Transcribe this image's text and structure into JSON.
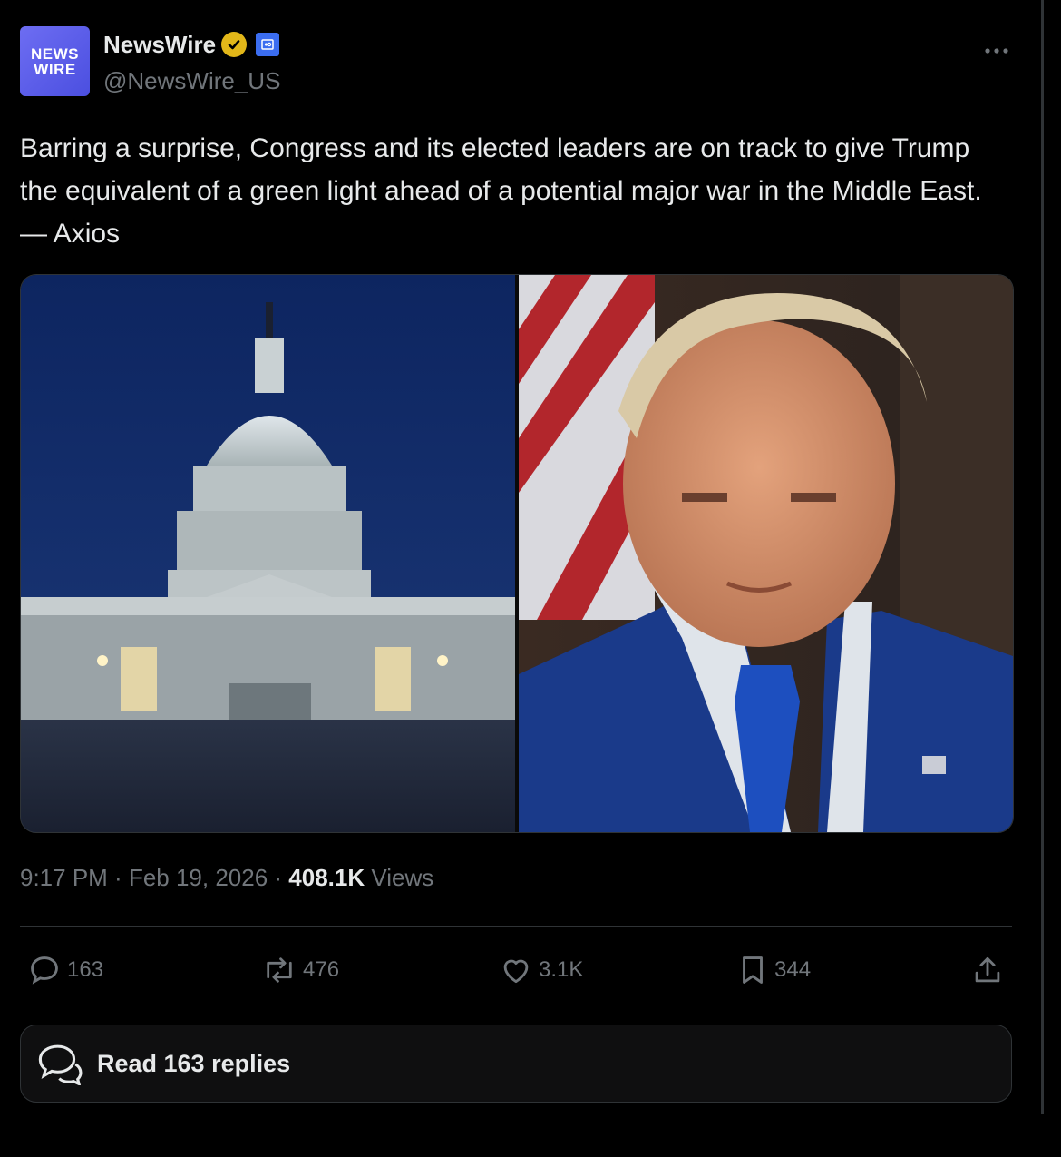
{
  "account": {
    "display_name": "NewsWire",
    "handle": "@NewsWire_US",
    "avatar_line1": "NEWS",
    "avatar_line2": "WIRE",
    "verified_color": "#e2b719",
    "affiliate_color": "#3b6df0"
  },
  "menu_icon": "more-horizontal-icon",
  "tweet": {
    "text": "Barring a surprise, Congress and its elected leaders are on track to give Trump the equivalent of a green light ahead of a potential major war in the Middle East. — Axios",
    "time": "9:17 PM",
    "sep1": " · ",
    "date": "Feb 19, 2026",
    "sep2": " · ",
    "views_count": "408.1K",
    "views_label": " Views"
  },
  "actions": {
    "replies": "163",
    "reposts": "476",
    "likes": "3.1K",
    "bookmarks": "344"
  },
  "read_replies_label": "Read 163 replies",
  "colors": {
    "background": "#000000",
    "muted": "#71767b",
    "text": "#e7e9ea",
    "border": "#2f3336"
  }
}
